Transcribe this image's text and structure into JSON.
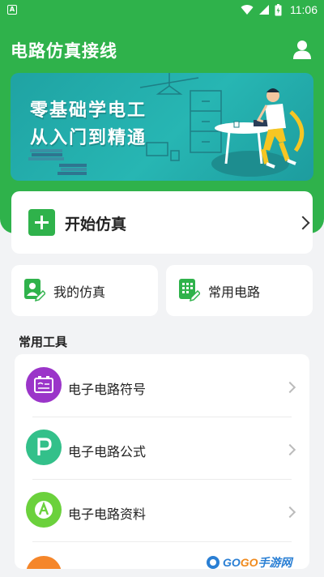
{
  "status_bar": {
    "badge": "A",
    "time": "11:06",
    "icons": [
      "wifi-icon",
      "signal-icon",
      "battery-icon"
    ]
  },
  "header": {
    "title": "电路仿真接线",
    "user_icon": "user-icon"
  },
  "banner": {
    "line1": "零基础学电工",
    "line2": "从入门到精通"
  },
  "start_card": {
    "label": "开始仿真",
    "icon": "plus-icon"
  },
  "quick_cards": [
    {
      "label": "我的仿真",
      "icon": "my-simulation-icon"
    },
    {
      "label": "常用电路",
      "icon": "common-circuit-icon"
    }
  ],
  "tools_section": {
    "title": "常用工具",
    "items": [
      {
        "label": "电子电路符号",
        "icon": "symbol-icon",
        "color": "#9b35c9"
      },
      {
        "label": "电子电路公式",
        "icon": "formula-p-icon",
        "color": "#33c08a"
      },
      {
        "label": "电子电路资料",
        "icon": "materials-icon",
        "color": "#6bd13c"
      },
      {
        "label": "",
        "icon": "partial-tool-icon",
        "color": "#f5862a"
      }
    ]
  },
  "watermark": {
    "brand_a": "GO",
    "brand_b": "GO",
    "suffix": "手游网"
  },
  "colors": {
    "primary": "#2fb24b",
    "banner": "#22aaa8",
    "background": "#f2f3f5"
  }
}
